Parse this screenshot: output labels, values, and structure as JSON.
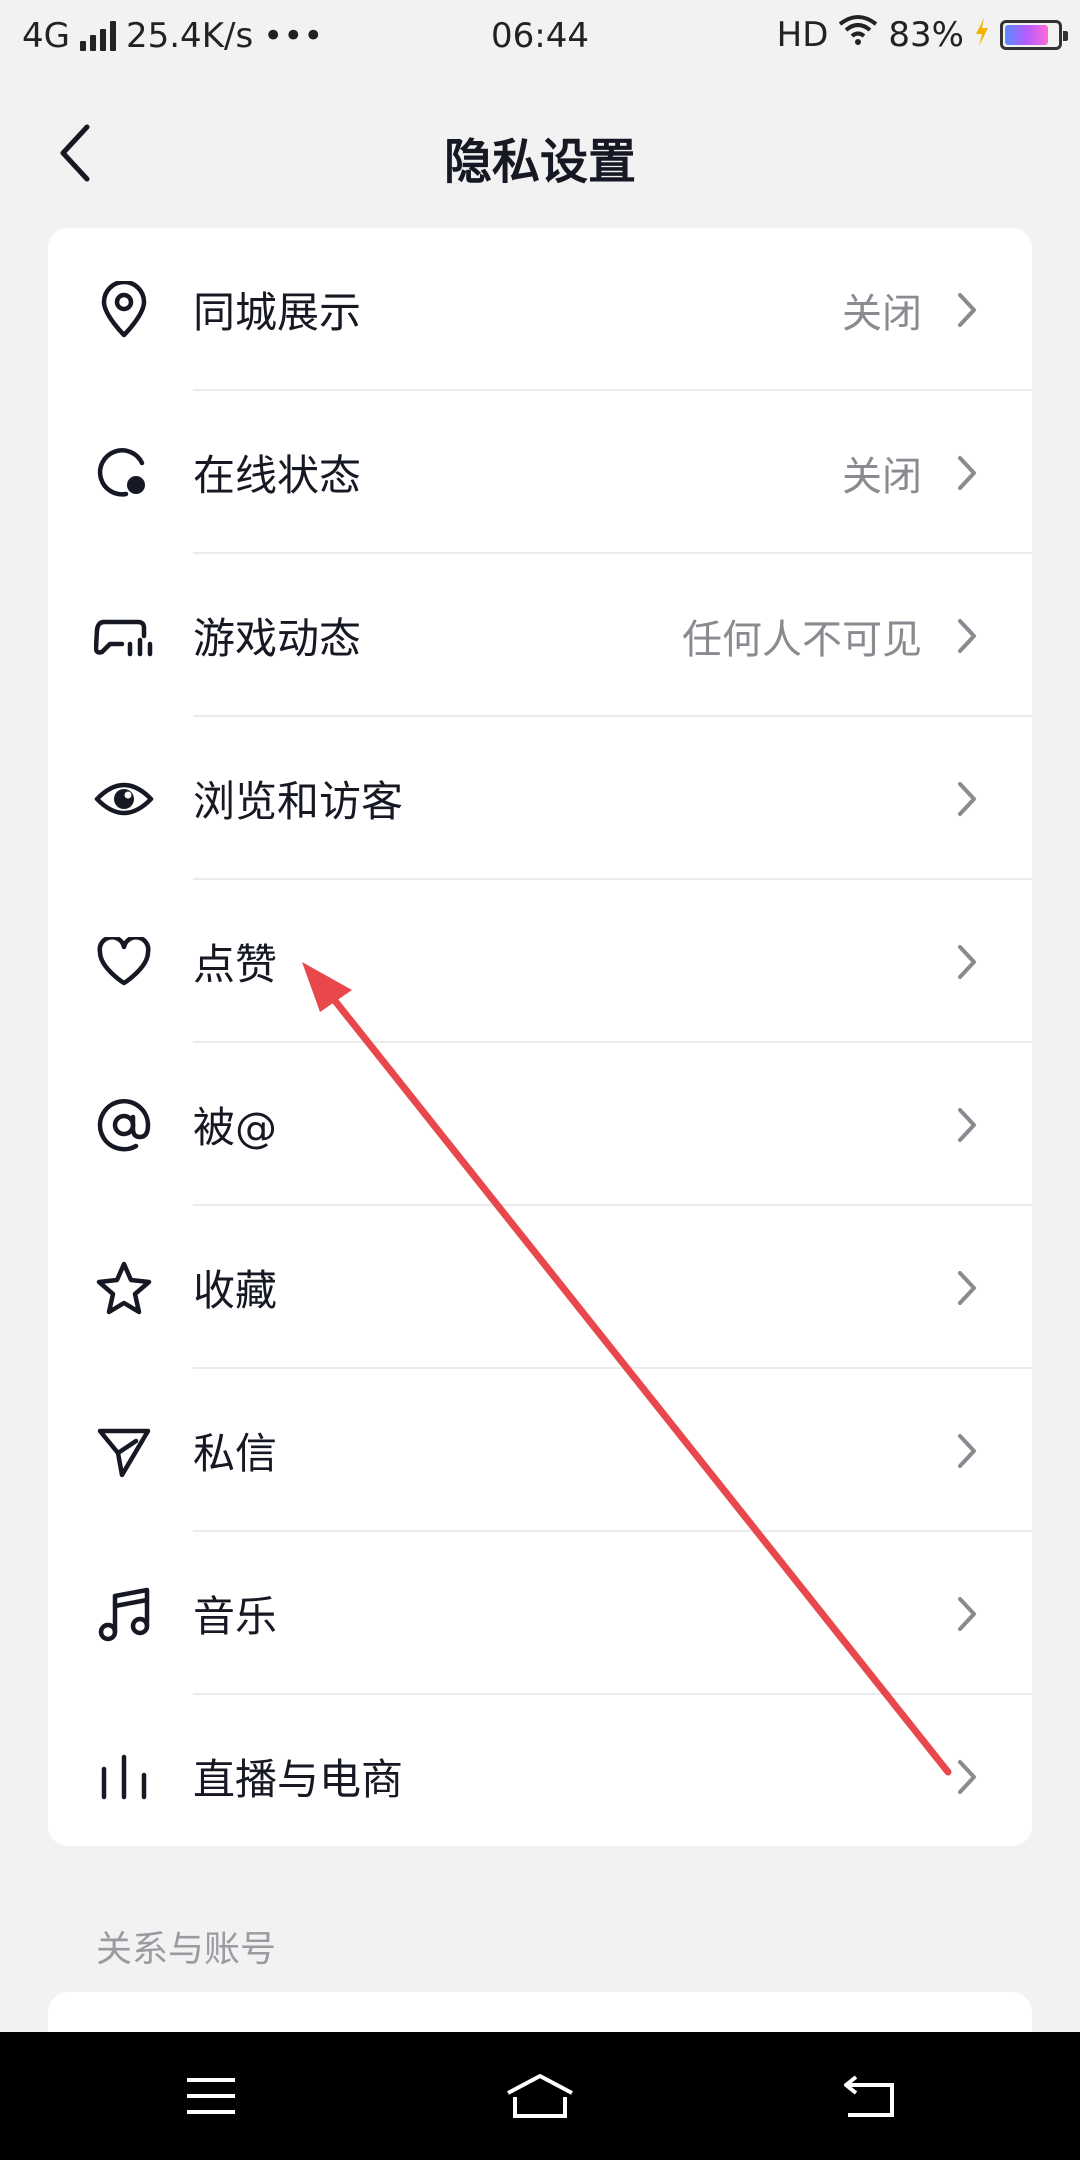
{
  "status_bar": {
    "network": "4G",
    "speed": "25.4K/s",
    "more": "•••",
    "time": "06:44",
    "hd": "HD",
    "battery": "83%",
    "battery_level": 0.83
  },
  "header": {
    "title": "隐私设置"
  },
  "settings": [
    {
      "label": "同城展示",
      "value": "关闭",
      "icon": "location-pin-icon"
    },
    {
      "label": "在线状态",
      "value": "关闭",
      "icon": "online-status-icon"
    },
    {
      "label": "游戏动态",
      "value": "任何人不可见",
      "icon": "gamepad-icon"
    },
    {
      "label": "浏览和访客",
      "value": "",
      "icon": "eye-icon"
    },
    {
      "label": "点赞",
      "value": "",
      "icon": "heart-icon"
    },
    {
      "label": "被@",
      "value": "",
      "icon": "at-icon"
    },
    {
      "label": "收藏",
      "value": "",
      "icon": "star-icon"
    },
    {
      "label": "私信",
      "value": "",
      "icon": "send-icon"
    },
    {
      "label": "音乐",
      "value": "",
      "icon": "music-note-icon"
    },
    {
      "label": "直播与电商",
      "value": "",
      "icon": "live-bars-icon"
    }
  ],
  "section": {
    "title": "关系与账号"
  },
  "colors": {
    "background": "#f2f2f3",
    "card": "#ffffff",
    "text": "#161823",
    "secondary": "#8a8b91",
    "annotation_arrow": "#e8474c"
  }
}
